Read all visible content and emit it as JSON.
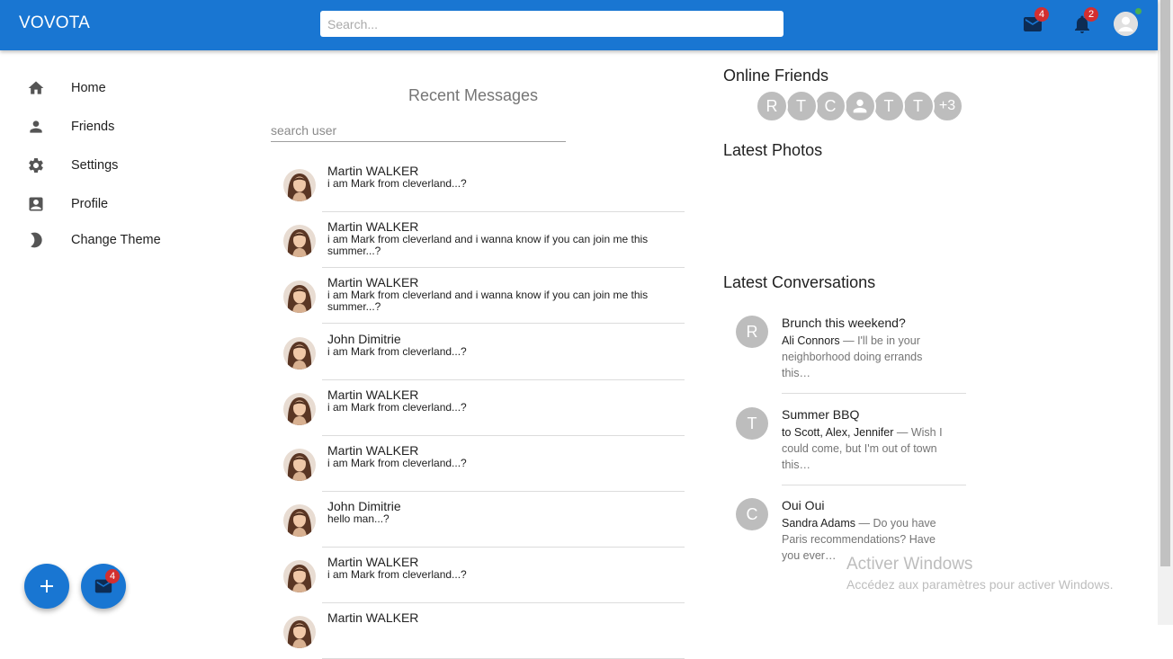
{
  "header": {
    "brand": "VOVOTA",
    "search_placeholder": "Search...",
    "mail_badge": "4",
    "notifications_badge": "2"
  },
  "sidebar": {
    "items": [
      {
        "label": "Home",
        "icon": "home-icon"
      },
      {
        "label": "Friends",
        "icon": "person-icon"
      },
      {
        "label": "Settings",
        "icon": "gear-icon"
      },
      {
        "label": "Profile",
        "icon": "contact-card-icon"
      },
      {
        "label": "Change Theme",
        "icon": "moon-icon"
      }
    ]
  },
  "fabs": {
    "add_icon": "plus-icon",
    "mail_icon": "mail-icon",
    "mail_badge": "4"
  },
  "messages": {
    "title": "Recent Messages",
    "search_placeholder": "search user",
    "items": [
      {
        "name": "Martin WALKER",
        "text": "i am Mark from cleverland...?"
      },
      {
        "name": "Martin WALKER",
        "text": "i am Mark from cleverland and i wanna know if you can join me this summer...?"
      },
      {
        "name": "Martin WALKER",
        "text": "i am Mark from cleverland and i wanna know if you can join me this summer...?"
      },
      {
        "name": "John Dimitrie",
        "text": "i am Mark from cleverland...?"
      },
      {
        "name": "Martin WALKER",
        "text": "i am Mark from cleverland...?"
      },
      {
        "name": "Martin WALKER",
        "text": "i am Mark from cleverland...?"
      },
      {
        "name": "John Dimitrie",
        "text": "hello man...?"
      },
      {
        "name": "Martin WALKER",
        "text": "i am Mark from cleverland...?"
      },
      {
        "name": "Martin WALKER",
        "text": ""
      }
    ]
  },
  "online_friends": {
    "title": "Online Friends",
    "avatars": [
      "R",
      "T",
      "C",
      "",
      "T",
      "T",
      "+3"
    ]
  },
  "photos": {
    "title": "Latest Photos"
  },
  "conversations": {
    "title": "Latest Conversations",
    "items": [
      {
        "initial": "R",
        "title": "Brunch this weekend?",
        "who": "Ali Connors",
        "text": " — I'll be in your neighborhood doing errands this…"
      },
      {
        "initial": "T",
        "title": "Summer BBQ",
        "who": "to Scott, Alex, Jennifer",
        "text": " — Wish I could come, but I'm out of town this…"
      },
      {
        "initial": "C",
        "title": "Oui Oui",
        "who": "Sandra Adams",
        "text": " — Do you have Paris recommendations? Have you ever…"
      }
    ]
  },
  "watermark": {
    "line1": "Activer Windows",
    "line2": "Accédez aux paramètres pour activer Windows."
  },
  "colors": {
    "primary": "#1976d2",
    "badge": "#d32f2f",
    "online": "#4caf50",
    "avatar_grey": "#bdbdbd"
  }
}
